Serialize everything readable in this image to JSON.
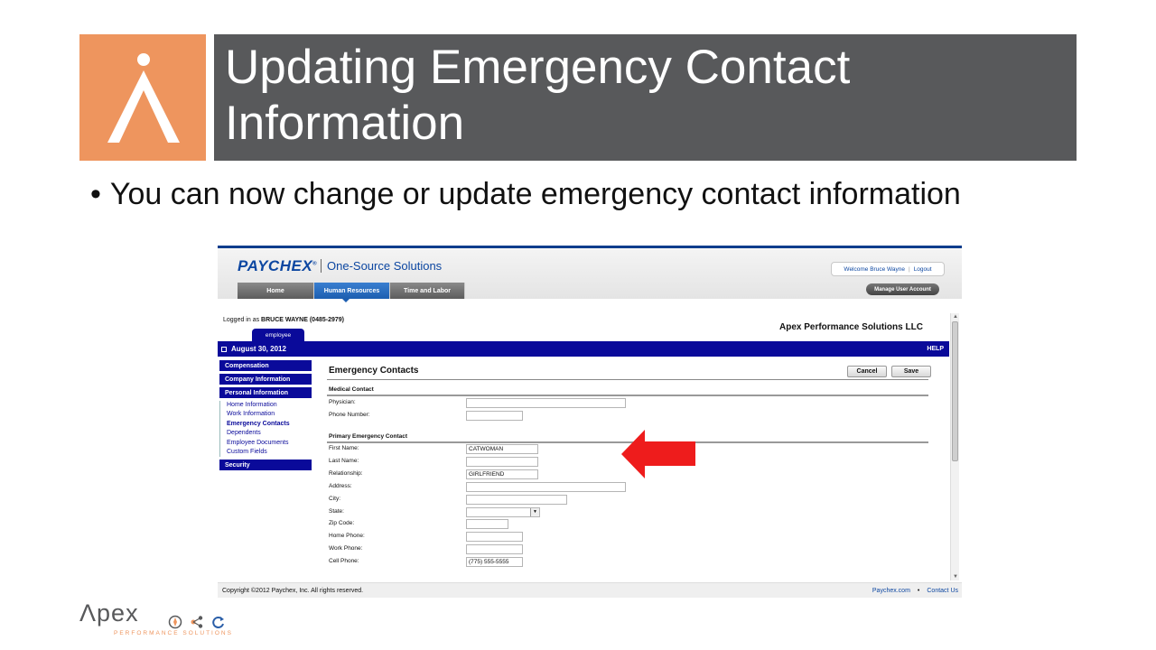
{
  "slide": {
    "title_line1": "Updating Emergency Contact",
    "title_line2": "Information",
    "bullet": "You can now change or update emergency contact information",
    "accent_color": "#ee955e",
    "title_bg": "#58595b"
  },
  "app": {
    "brand": "PAYCHEX",
    "brand_mark": "®",
    "product": "One-Source Solutions",
    "tabs": [
      {
        "label": "Home",
        "active": false
      },
      {
        "label": "Human Resources",
        "active": true
      },
      {
        "label": "Time and Labor",
        "active": false
      }
    ],
    "welcome": "Welcome Bruce Wayne",
    "logout": "Logout",
    "manage_account": "Manage User Account",
    "logged_in_prefix": "Logged in as",
    "logged_in_user": "BRUCE WAYNE (0485-2979)",
    "employee_tab": "employee",
    "company": "Apex Performance Solutions LLC",
    "date": "August 30, 2012",
    "help": "HELP",
    "nav": {
      "compensation": "Compensation",
      "company_information": "Company Information",
      "personal_information": "Personal Information",
      "sub_items": [
        "Home Information",
        "Work Information",
        "Emergency Contacts",
        "Dependents",
        "Employee Documents",
        "Custom Fields"
      ],
      "current_item": "Emergency Contacts",
      "security": "Security"
    },
    "form": {
      "title": "Emergency Contacts",
      "cancel": "Cancel",
      "save": "Save",
      "medical_section": "Medical Contact",
      "medical_fields": [
        {
          "label": "Physician:",
          "value": ""
        },
        {
          "label": "Phone Number:",
          "value": ""
        }
      ],
      "primary_section": "Primary Emergency Contact",
      "primary_fields": [
        {
          "label": "First Name:",
          "value": "CATWOMAN"
        },
        {
          "label": "Last Name:",
          "value": ""
        },
        {
          "label": "Relationship:",
          "value": "GIRLFRIEND"
        },
        {
          "label": "Address:",
          "value": ""
        },
        {
          "label": "City:",
          "value": ""
        },
        {
          "label": "State:",
          "value": ""
        },
        {
          "label": "Zip Code:",
          "value": ""
        },
        {
          "label": "Home Phone:",
          "value": ""
        },
        {
          "label": "Work Phone:",
          "value": ""
        },
        {
          "label": "Cell Phone:",
          "value": "(775) 555-5555"
        }
      ]
    },
    "footer": {
      "copyright": "Copyright ©2012 Paychex, Inc. All rights reserved.",
      "link1": "Paychex.com",
      "link2": "Contact Us"
    }
  },
  "bottom_logo": {
    "word": "Λpex",
    "tagline": "PERFORMANCE SOLUTIONS"
  }
}
